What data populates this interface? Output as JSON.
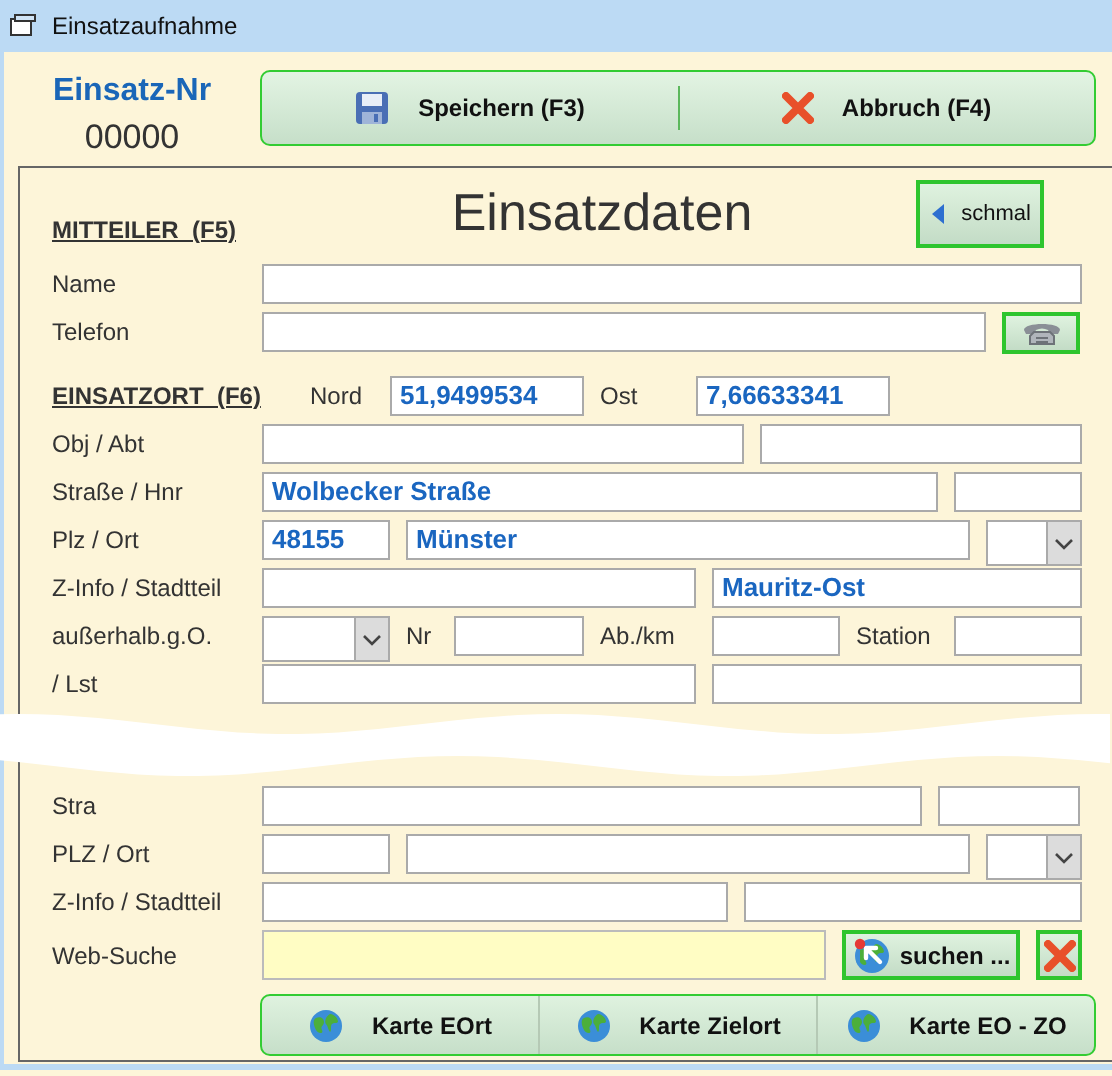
{
  "window": {
    "title": "Einsatzaufnahme"
  },
  "header": {
    "number_label": "Einsatz-Nr",
    "number": "00000",
    "buttons": [
      {
        "kind": "save",
        "label": "Speichern (F3)"
      },
      {
        "kind": "cancel",
        "label": "Abbruch (F4)"
      }
    ]
  },
  "panel": {
    "heading": "MITTEILER  (F5)",
    "title": "Einsatzdaten",
    "toggle_button": {
      "label": "schmal"
    },
    "rows": [
      {
        "items": [
          {
            "kind": "label",
            "text": "Name"
          },
          {
            "kind": "field"
          }
        ]
      },
      {
        "items": [
          {
            "kind": "label",
            "text": "Telefon"
          },
          {
            "kind": "field"
          },
          {
            "kind": "phone_button"
          }
        ]
      },
      {
        "items": [
          {
            "kind": "heading",
            "text": "EINSATZORT  (F6)"
          },
          {
            "kind": "label",
            "text": "Nord"
          },
          {
            "kind": "field",
            "value": "51,9499534"
          },
          {
            "kind": "label",
            "text": "Ost"
          },
          {
            "kind": "field",
            "value": "7,66633341"
          }
        ]
      },
      {
        "items": [
          {
            "kind": "label",
            "text": "Obj / Abt"
          },
          {
            "kind": "field"
          },
          {
            "kind": "field"
          }
        ]
      },
      {
        "items": [
          {
            "kind": "label",
            "text": "Straße / Hnr"
          },
          {
            "kind": "field",
            "value": "Wolbecker Straße"
          },
          {
            "kind": "field"
          }
        ]
      },
      {
        "items": [
          {
            "kind": "label",
            "text": "Plz / Ort"
          },
          {
            "kind": "field",
            "value": "48155"
          },
          {
            "kind": "field",
            "value": "Münster"
          },
          {
            "kind": "combo"
          }
        ]
      },
      {
        "items": [
          {
            "kind": "label",
            "text": "Z-Info / Stadtteil"
          },
          {
            "kind": "field"
          },
          {
            "kind": "field",
            "value": "Mauritz-Ost"
          }
        ]
      },
      {
        "items": [
          {
            "kind": "label",
            "text": "außerhalb.g.O."
          },
          {
            "kind": "combo"
          },
          {
            "kind": "label",
            "text": "Nr"
          },
          {
            "kind": "field"
          },
          {
            "kind": "label",
            "text": "Ab./km"
          },
          {
            "kind": "field"
          },
          {
            "kind": "label",
            "text": "Station"
          },
          {
            "kind": "field"
          }
        ]
      },
      {
        "items": [
          {
            "kind": "label",
            "text": "/ Lst"
          },
          {
            "kind": "field"
          },
          {
            "kind": "field"
          }
        ]
      },
      {
        "items": [
          {
            "kind": "tear"
          }
        ]
      },
      {
        "items": [
          {
            "kind": "label",
            "text": "Stra"
          },
          {
            "kind": "field"
          },
          {
            "kind": "field"
          }
        ]
      },
      {
        "items": [
          {
            "kind": "label",
            "text": "PLZ / Ort"
          },
          {
            "kind": "field"
          },
          {
            "kind": "field"
          },
          {
            "kind": "combo"
          }
        ]
      },
      {
        "items": [
          {
            "kind": "label",
            "text": "Z-Info / Stadtteil"
          },
          {
            "kind": "field"
          },
          {
            "kind": "field"
          }
        ]
      },
      {
        "items": [
          {
            "kind": "label",
            "text": "Web-Suche"
          },
          {
            "kind": "search_field"
          },
          {
            "kind": "search_button",
            "label": "suchen ..."
          },
          {
            "kind": "clear_button"
          }
        ]
      }
    ],
    "map_buttons": [
      {
        "label": "Karte EOrt"
      },
      {
        "label": "Karte Zielort"
      },
      {
        "label": "Karte EO - ZO"
      }
    ]
  }
}
